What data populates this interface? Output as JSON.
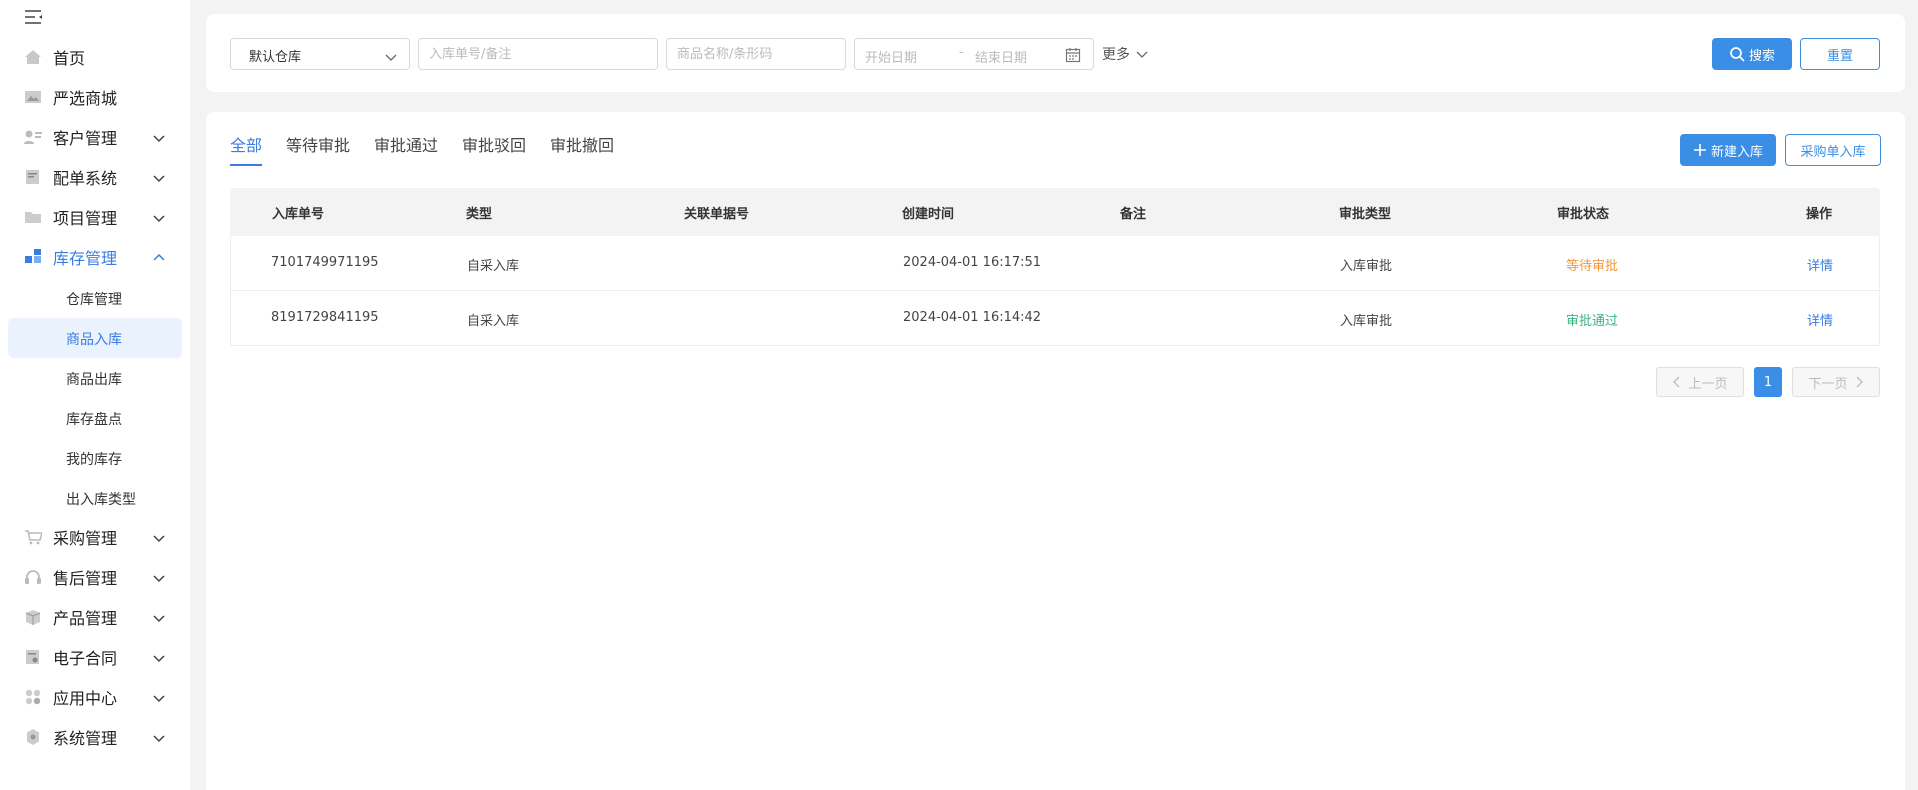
{
  "sidebar": {
    "items": [
      {
        "label": "首页"
      },
      {
        "label": "严选商城"
      },
      {
        "label": "客户管理"
      },
      {
        "label": "配单系统"
      },
      {
        "label": "项目管理"
      },
      {
        "label": "库存管理"
      },
      {
        "label": "采购管理"
      },
      {
        "label": "售后管理"
      },
      {
        "label": "产品管理"
      },
      {
        "label": "电子合同"
      },
      {
        "label": "应用中心"
      },
      {
        "label": "系统管理"
      }
    ],
    "sub_items": [
      {
        "label": "仓库管理"
      },
      {
        "label": "商品入库"
      },
      {
        "label": "商品出库"
      },
      {
        "label": "库存盘点"
      },
      {
        "label": "我的库存"
      },
      {
        "label": "出入库类型"
      }
    ]
  },
  "filters": {
    "warehouse_value": "默认仓库",
    "order_placeholder": "入库单号/备注",
    "product_placeholder": "商品名称/条形码",
    "start_date_placeholder": "开始日期",
    "date_separator": "-",
    "end_date_placeholder": "结束日期",
    "more_label": "更多",
    "search_label": "搜索",
    "reset_label": "重置"
  },
  "tabs": [
    {
      "label": "全部"
    },
    {
      "label": "等待审批"
    },
    {
      "label": "审批通过"
    },
    {
      "label": "审批驳回"
    },
    {
      "label": "审批撤回"
    }
  ],
  "actions": {
    "new_label": "新建入库",
    "purchase_label": "采购单入库"
  },
  "table": {
    "headers": [
      "入库单号",
      "类型",
      "关联单据号",
      "创建时间",
      "备注",
      "审批类型",
      "审批状态",
      "操作"
    ],
    "rows": [
      {
        "order_no": "7101749971195",
        "type": "自采入库",
        "related": "",
        "created": "2024-04-01 16:17:51",
        "remark": "",
        "approval_type": "入库审批",
        "status": "等待审批",
        "action": "详情"
      },
      {
        "order_no": "8191729841195",
        "type": "自采入库",
        "related": "",
        "created": "2024-04-01 16:14:42",
        "remark": "",
        "approval_type": "入库审批",
        "status": "审批通过",
        "action": "详情"
      }
    ]
  },
  "pagination": {
    "prev_label": "上一页",
    "current_page": "1",
    "next_label": "下一页"
  },
  "colors": {
    "accent": "#3a8ee6",
    "status_wait": "#f0983a",
    "status_pass": "#3bb380"
  }
}
